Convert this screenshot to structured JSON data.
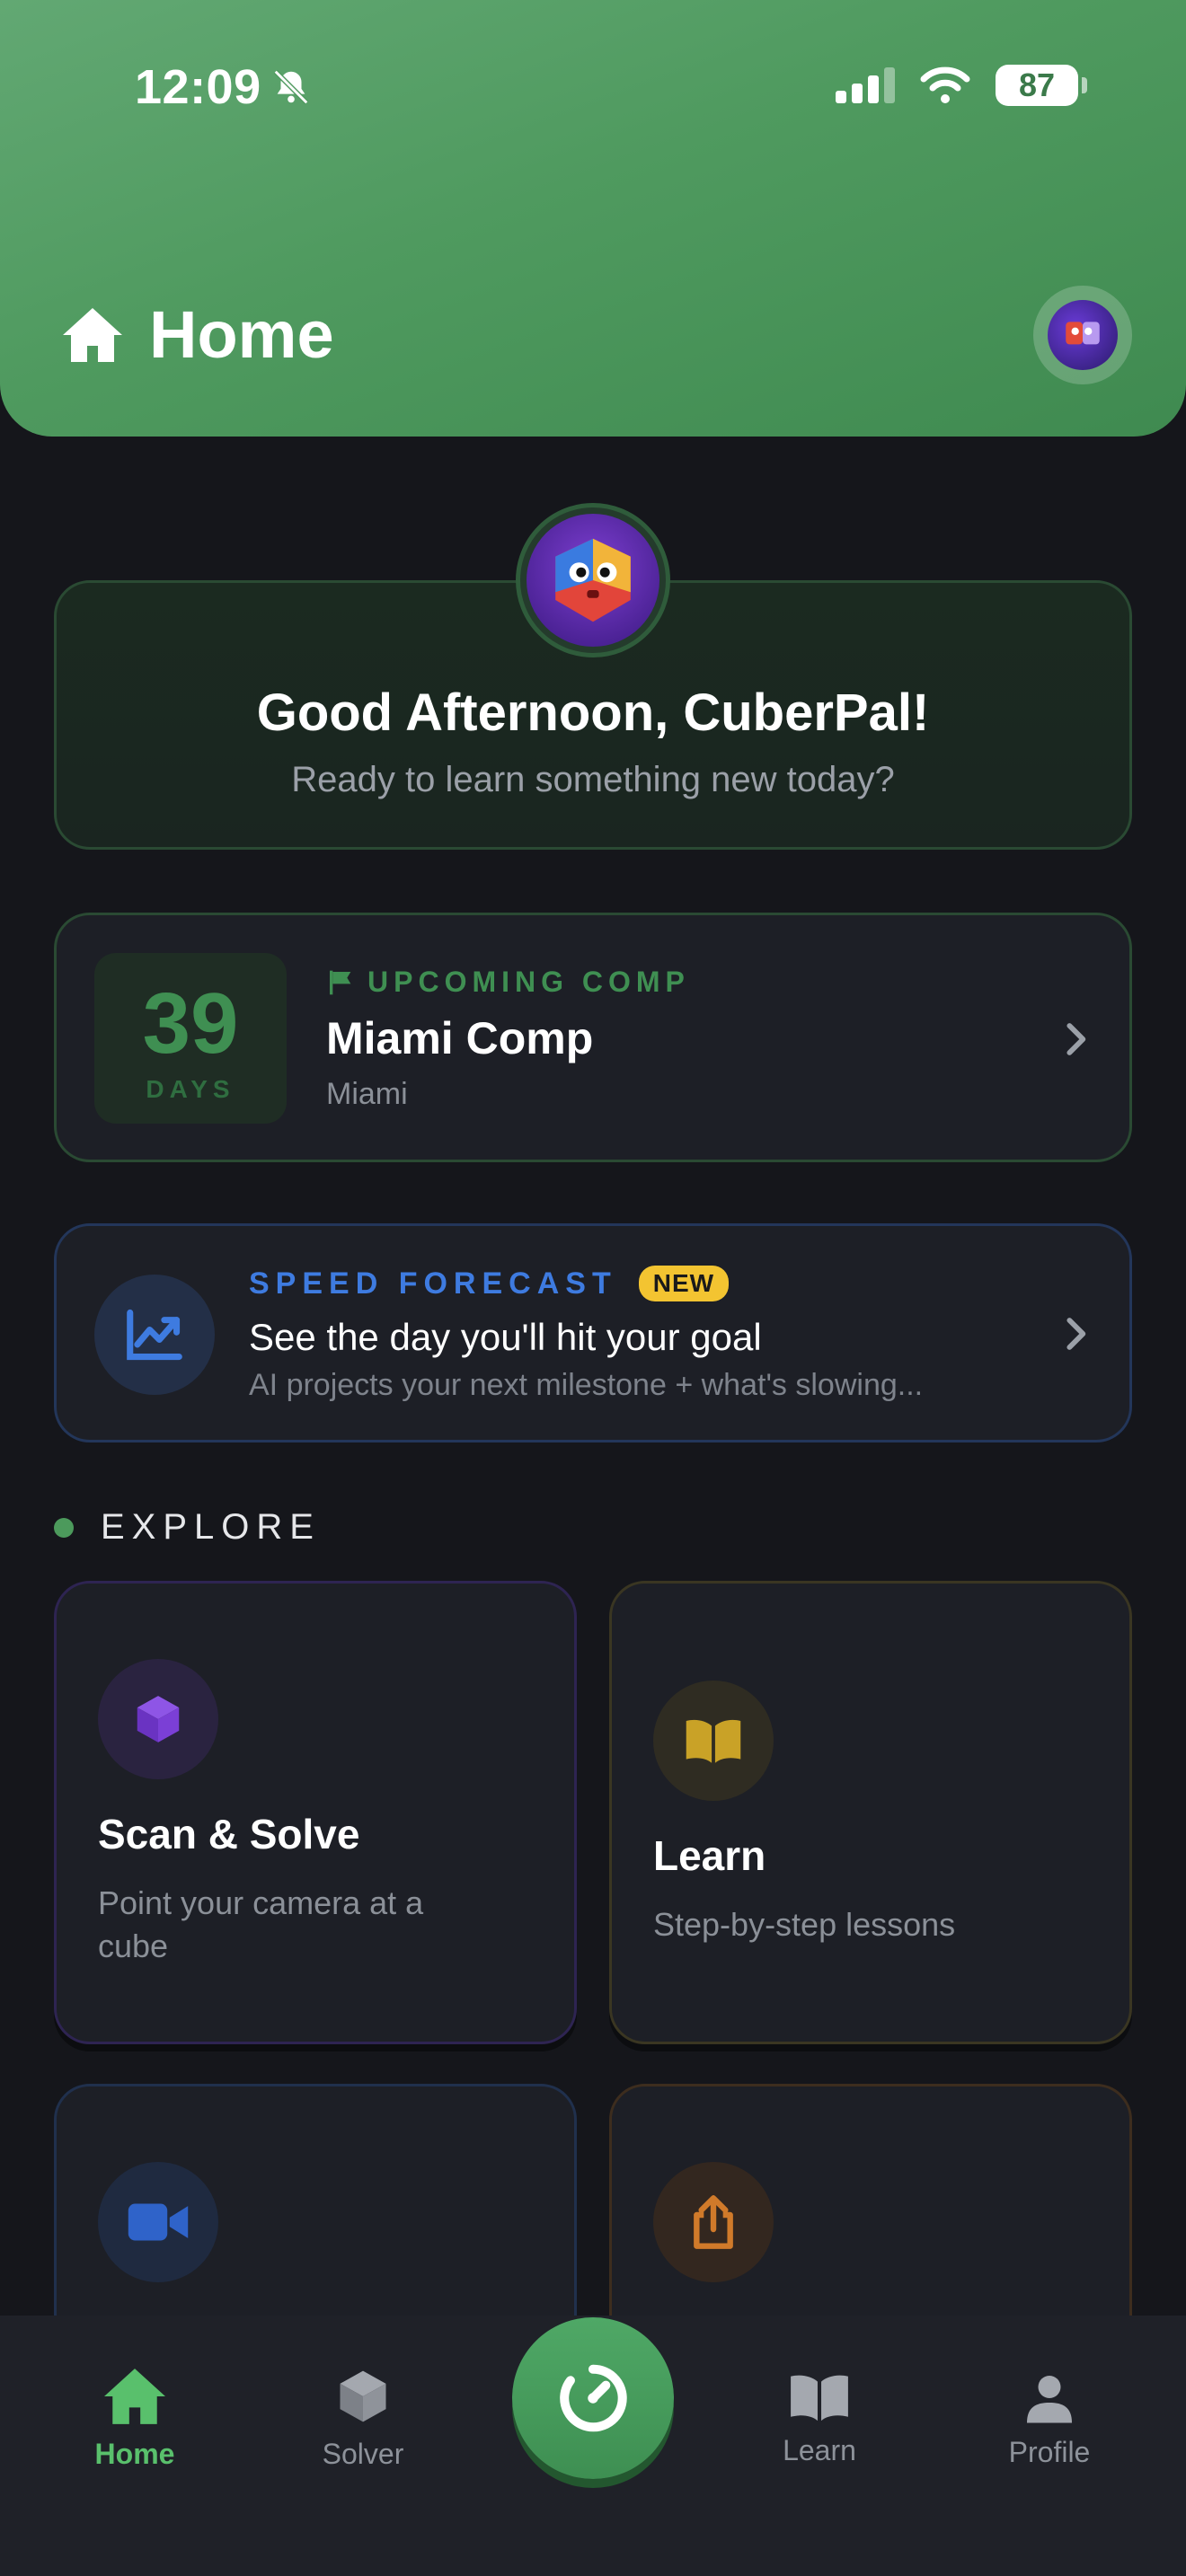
{
  "status_bar": {
    "time": "12:09",
    "battery": "87"
  },
  "header": {
    "title": "Home"
  },
  "greeting": {
    "title": "Good Afternoon, CuberPal!",
    "subtitle": "Ready to learn something new today?"
  },
  "comp": {
    "days": "39",
    "days_label": "DAYS",
    "tag": "UPCOMING COMP",
    "name": "Miami Comp",
    "location": "Miami"
  },
  "forecast": {
    "tag": "SPEED FORECAST",
    "badge": "NEW",
    "title": "See the day you'll hit your goal",
    "subtitle": "AI projects your next milestone + what's slowing..."
  },
  "explore": {
    "label": "EXPLORE",
    "tiles": [
      {
        "title": "Scan & Solve",
        "subtitle": "Point your camera at a cube",
        "icon": "cube-icon",
        "color": "#7b3fd6"
      },
      {
        "title": "Learn",
        "subtitle": "Step-by-step lessons",
        "icon": "book-icon",
        "color": "#c9a227"
      },
      {
        "title": "",
        "subtitle": "",
        "icon": "video-icon",
        "color": "#2f63c9"
      },
      {
        "title": "",
        "subtitle": "",
        "icon": "share-icon",
        "color": "#d07a2a"
      }
    ]
  },
  "tabs": [
    {
      "label": "Home",
      "icon": "home-icon",
      "active": true
    },
    {
      "label": "Solver",
      "icon": "cube-icon"
    },
    {
      "label": "",
      "icon": "timer-icon"
    },
    {
      "label": "Learn",
      "icon": "book-icon"
    },
    {
      "label": "Profile",
      "icon": "person-icon"
    }
  ],
  "colors": {
    "accent": "#4f9a5f",
    "forecast": "#3e7be0",
    "badge": "#f3c431"
  }
}
